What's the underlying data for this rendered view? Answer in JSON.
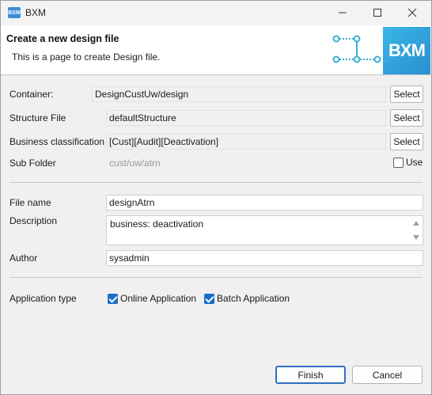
{
  "window": {
    "title": "BXM",
    "icon_label": "BXM"
  },
  "banner": {
    "title": "Create a new design file",
    "subtitle": "This is a page to create Design file.",
    "logo_text": "BXM"
  },
  "form": {
    "container": {
      "label": "Container:",
      "value": "DesignCustUw/design",
      "button": "Select"
    },
    "structure": {
      "label": "Structure File",
      "value": "defaultStructure",
      "button": "Select"
    },
    "business": {
      "label": "Business classification",
      "value": "[Cust][Audit][Deactivation]",
      "button": "Select"
    },
    "subfolder": {
      "label": "Sub Folder",
      "value": "cust/uw/atrn",
      "use_label": "Use",
      "use_checked": false
    },
    "filename": {
      "label": "File name",
      "value": "designAtrn"
    },
    "description": {
      "label": "Description",
      "value": "business: deactivation"
    },
    "author": {
      "label": "Author",
      "value": "sysadmin"
    },
    "app_type": {
      "label": "Application type",
      "online": {
        "label": "Online Application",
        "checked": true
      },
      "batch": {
        "label": "Batch Application",
        "checked": true
      }
    }
  },
  "footer": {
    "finish": "Finish",
    "cancel": "Cancel"
  },
  "colors": {
    "accent": "#1a6dc7",
    "logo": "#2a9fd9",
    "banner_graphic": "#3aaecf"
  }
}
